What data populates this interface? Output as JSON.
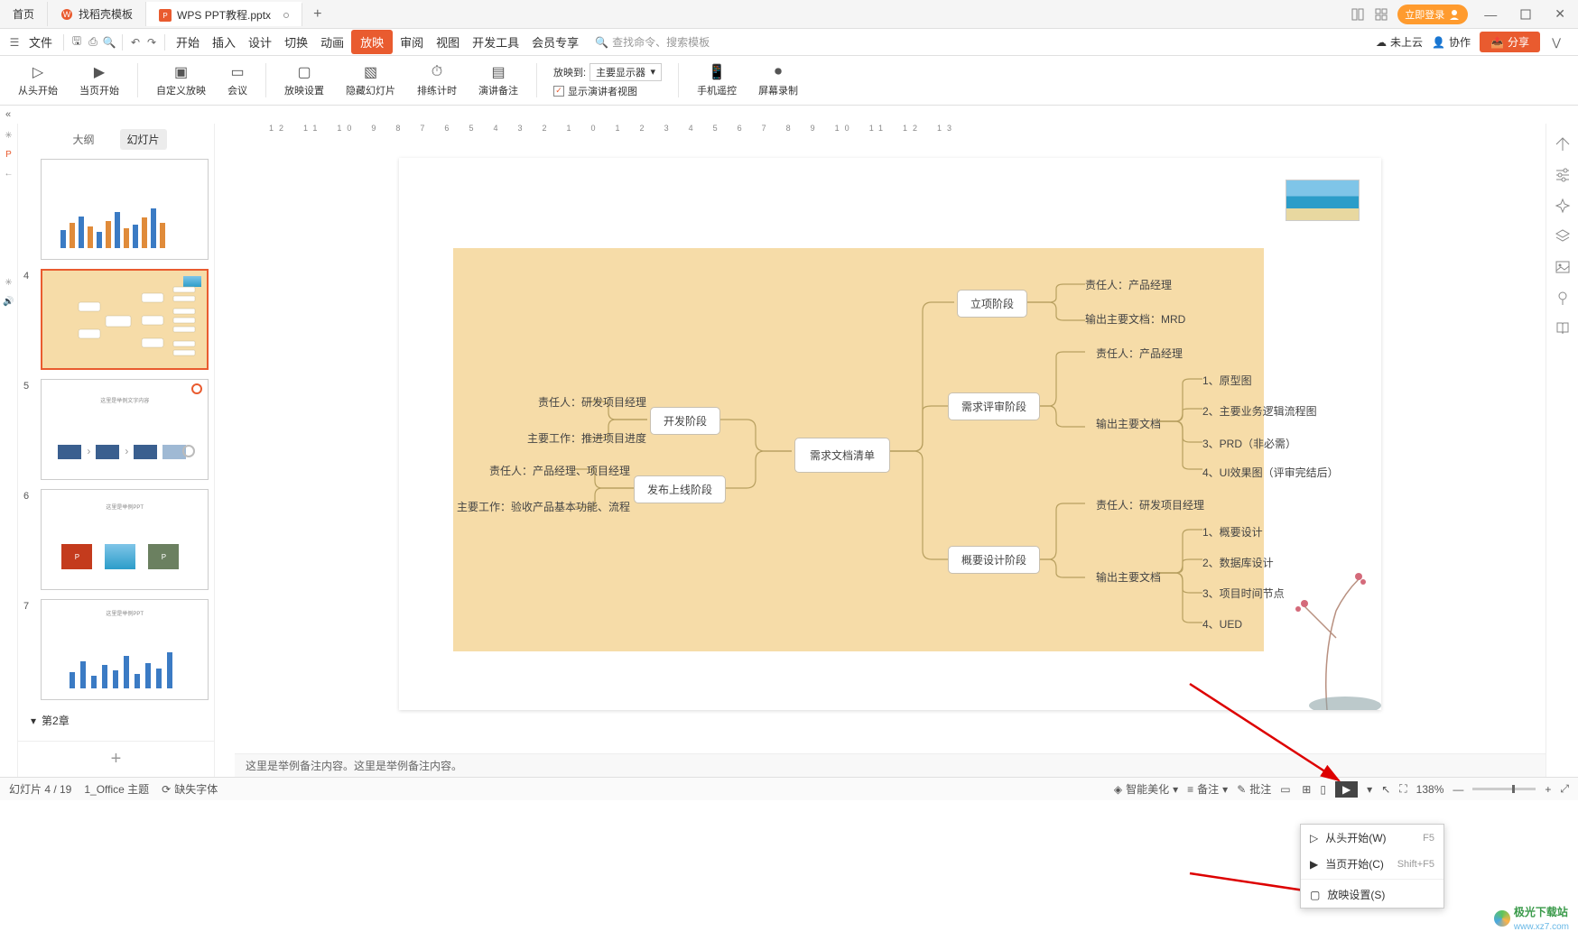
{
  "tabs": {
    "home": "首页",
    "templates": "找稻壳模板",
    "doc": "WPS PPT教程.pptx",
    "add": "+"
  },
  "titlebar": {
    "login": "立即登录"
  },
  "menubar": {
    "file": "文件",
    "items": [
      "开始",
      "插入",
      "设计",
      "切换",
      "动画",
      "放映",
      "审阅",
      "视图",
      "开发工具",
      "会员专享"
    ],
    "active_index": 5,
    "search_placeholder": "查找命令、搜索模板"
  },
  "topright": {
    "notup": "未上云",
    "coop": "协作",
    "share": "分享"
  },
  "ribbon": {
    "fromstart": "从头开始",
    "curpage": "当页开始",
    "custom": "自定义放映",
    "meeting": "会议",
    "settings": "放映设置",
    "hide": "隐藏幻灯片",
    "timing": "排练计时",
    "notes": "演讲备注",
    "target_label": "放映到:",
    "target_value": "主要显示器",
    "presenter": "显示演讲者视图",
    "phone": "手机遥控",
    "record": "屏幕录制"
  },
  "thumbs": {
    "outline": "大纲",
    "slides": "幻灯片",
    "nums": [
      "4",
      "5",
      "6",
      "7"
    ],
    "chapter": "第2章",
    "add": "+"
  },
  "notes": "这里是举例备注内容。这里是举例备注内容。",
  "slide": {
    "center": "需求文档清单",
    "dev": "开发阶段",
    "dev_l1": "责任人：研发项目经理",
    "dev_l2": "主要工作：推进项目进度",
    "rel": "发布上线阶段",
    "rel_l1": "责任人：产品经理、项目经理",
    "rel_l2": "主要工作：验收产品基本功能、流程",
    "init": "立项阶段",
    "init_l1": "责任人：产品经理",
    "init_l2": "输出主要文档：MRD",
    "rev": "需求评审阶段",
    "rev_p": "责任人：产品经理",
    "rev_o": "输出主要文档",
    "rev_items": [
      "1、原型图",
      "2、主要业务逻辑流程图",
      "3、PRD（非必需）",
      "4、UI效果图（评审完结后）"
    ],
    "des": "概要设计阶段",
    "des_p": "责任人：研发项目经理",
    "des_o": "输出主要文档",
    "des_items": [
      "1、概要设计",
      "2、数据库设计",
      "3、项目时间节点",
      "4、UED"
    ]
  },
  "popup": {
    "r1": "从头开始(W)",
    "r1s": "F5",
    "r2": "当页开始(C)",
    "r2s": "Shift+F5",
    "r3": "放映设置(S)"
  },
  "status": {
    "page": "幻灯片 4 / 19",
    "theme": "1_Office 主题",
    "miss": "缺失字体",
    "beauty": "智能美化",
    "note": "备注",
    "comment": "批注",
    "zoom": "138%"
  },
  "watermark": {
    "site": "极光下载站",
    "url": "www.xz7.com"
  }
}
